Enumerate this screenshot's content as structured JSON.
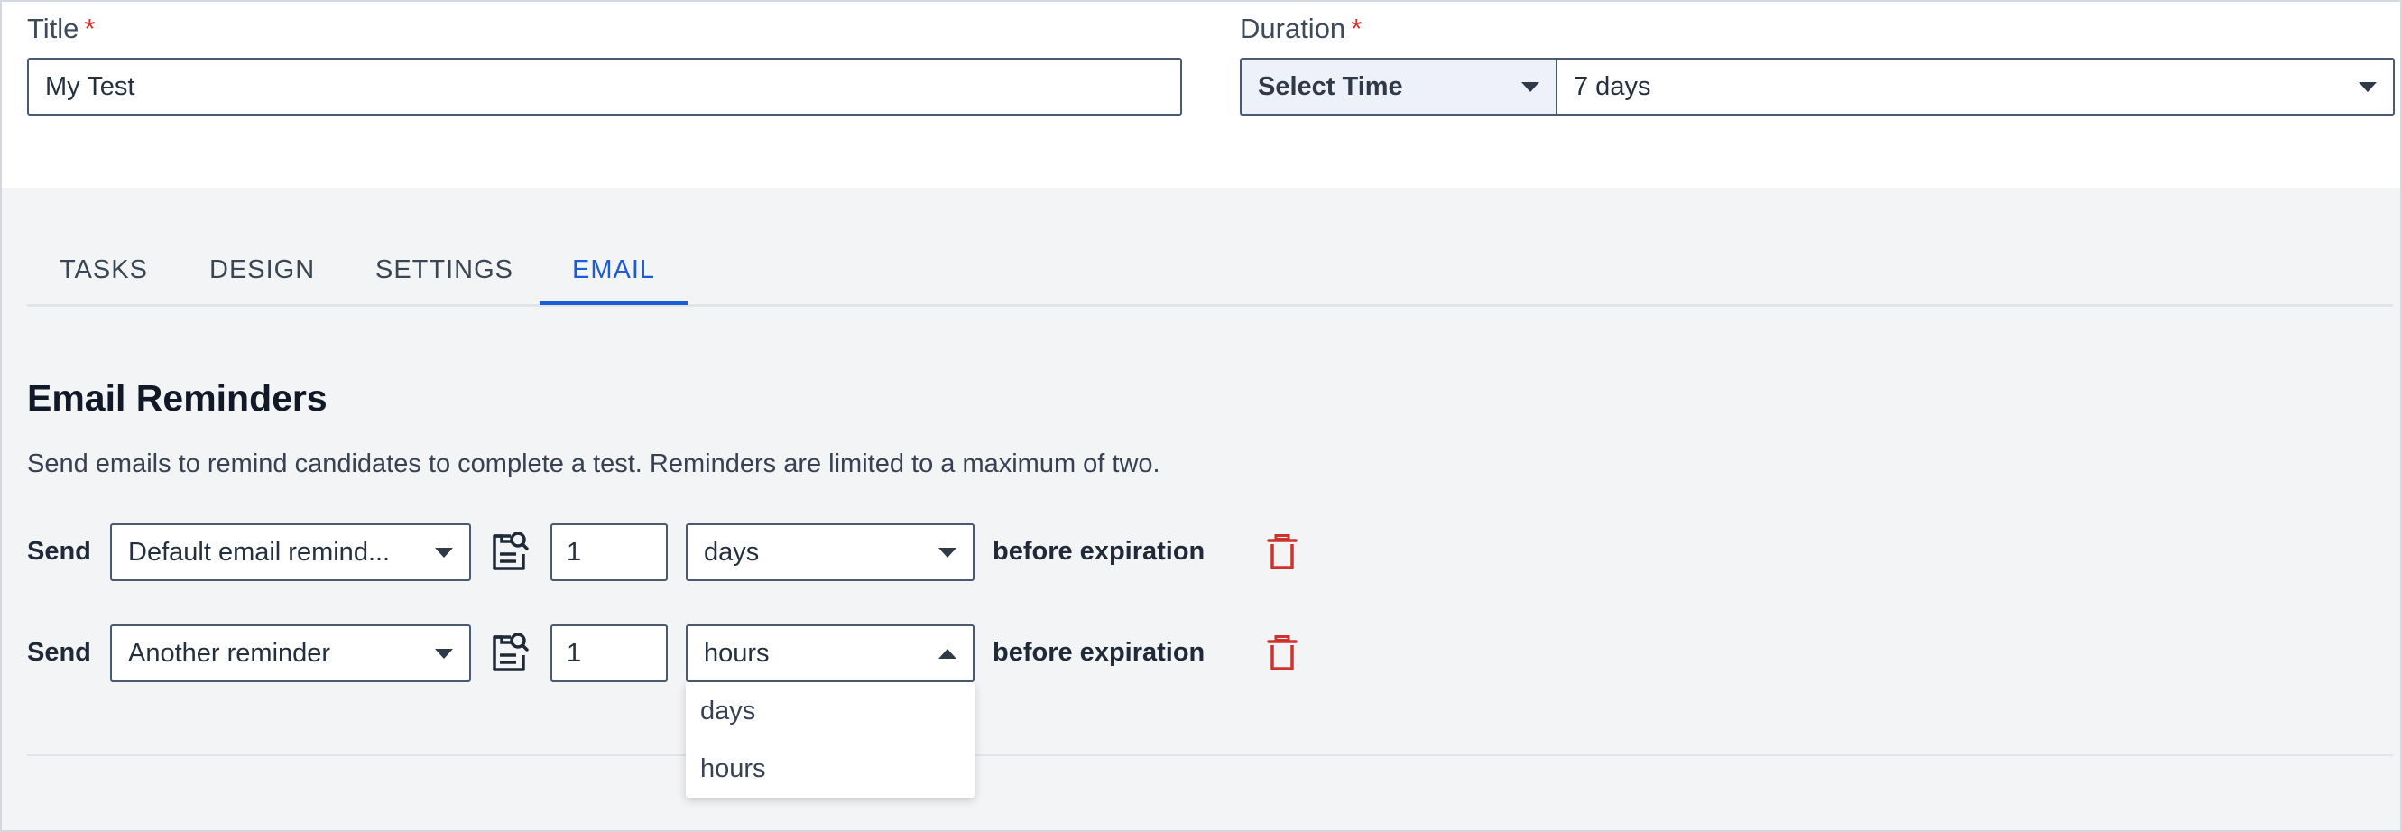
{
  "form": {
    "title_label": "Title",
    "title_value": "My Test",
    "duration_label": "Duration",
    "required_mark": "*",
    "duration_unit": "Select Time",
    "duration_value": "7 days"
  },
  "tabs": [
    {
      "label": "TASKS",
      "active": false
    },
    {
      "label": "DESIGN",
      "active": false
    },
    {
      "label": "SETTINGS",
      "active": false
    },
    {
      "label": "EMAIL",
      "active": true
    }
  ],
  "email": {
    "title": "Email Reminders",
    "description": "Send emails to remind candidates to complete a test. Reminders are limited to a maximum of two.",
    "reminders": [
      {
        "send_label": "Send",
        "template": "Default email remind...",
        "amount": "1",
        "unit": "days",
        "suffix": "before expiration",
        "dropdown_open": false
      },
      {
        "send_label": "Send",
        "template": "Another reminder",
        "amount": "1",
        "unit": "hours",
        "suffix": "before expiration",
        "dropdown_open": true
      }
    ],
    "unit_options": [
      "days",
      "hours"
    ]
  },
  "colors": {
    "accent": "#1e5bd8",
    "required": "#d0312d",
    "danger": "#d0312d",
    "panel_bg": "#f3f4f6"
  },
  "icons": {
    "preview": "preview-template-icon",
    "delete": "trash-icon",
    "dropdown": "caret-down-icon"
  }
}
